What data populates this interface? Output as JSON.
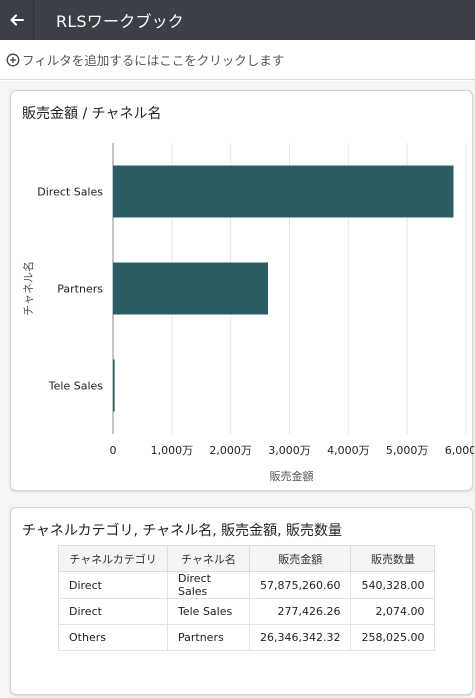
{
  "header": {
    "title": "RLSワークブック",
    "back_icon": "arrow-left-icon"
  },
  "filter_bar": {
    "icon": "add-circle-icon",
    "text": "フィルタを追加するにはここをクリックします"
  },
  "chart_card": {
    "title": "販売金額 / チャネル名"
  },
  "chart_data": {
    "type": "bar",
    "orientation": "horizontal",
    "categories": [
      "Direct Sales",
      "Partners",
      "Tele Sales"
    ],
    "values": [
      57875260.6,
      26346342.32,
      277426.26
    ],
    "bar_color": "#2a5e63",
    "xlabel": "販売金額",
    "ylabel": "チャネル名",
    "xlim": [
      0,
      60000000
    ],
    "x_ticks": [
      0,
      10000000,
      20000000,
      30000000,
      40000000,
      50000000,
      60000000
    ],
    "x_tick_labels": [
      "0",
      "1,000万",
      "2,000万",
      "3,000万",
      "4,000万",
      "5,000万",
      "6,000万"
    ],
    "grid": true
  },
  "table_card": {
    "title": "チャネルカテゴリ, チャネル名, 販売金額, 販売数量",
    "columns": [
      "チャネルカテゴリ",
      "チャネル名",
      "販売金額",
      "販売数量"
    ],
    "rows": [
      [
        "Direct",
        "Direct Sales",
        "57,875,260.60",
        "540,328.00"
      ],
      [
        "Direct",
        "Tele Sales",
        "277,426.26",
        "2,074.00"
      ],
      [
        "Others",
        "Partners",
        "26,346,342.32",
        "258,025.00"
      ]
    ]
  }
}
